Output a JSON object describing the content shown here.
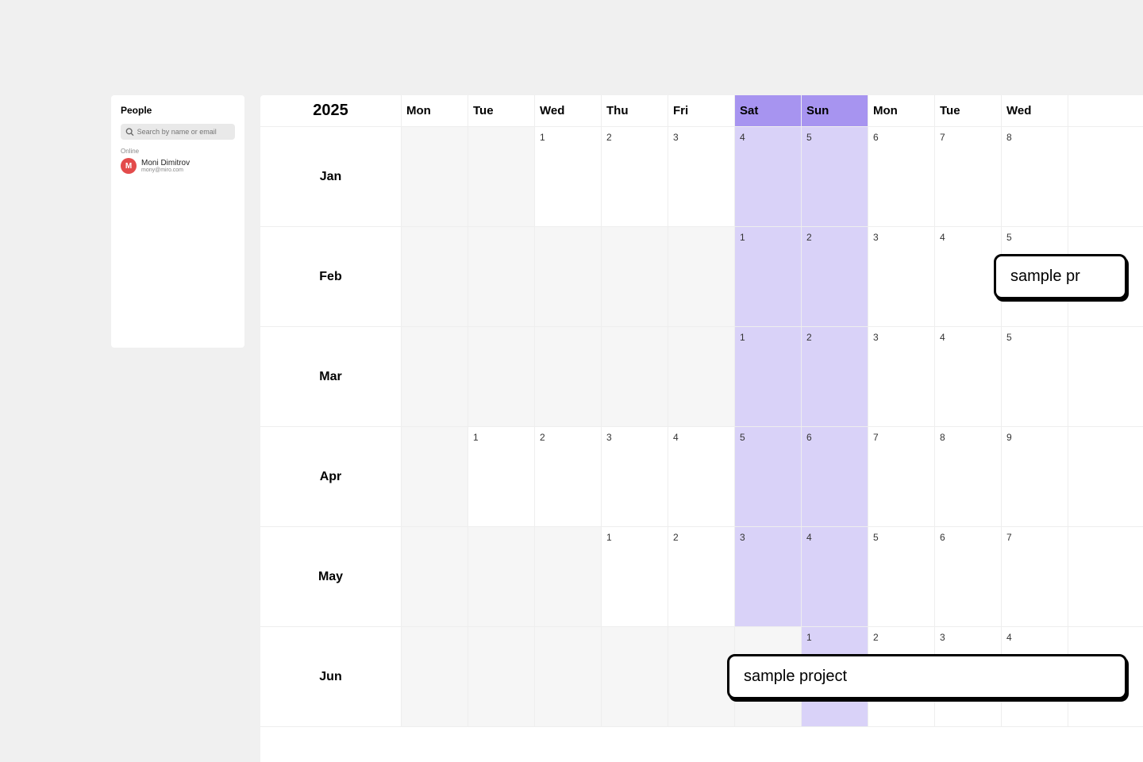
{
  "people": {
    "title": "People",
    "search_placeholder": "Search by name or email",
    "online_label": "Online",
    "user": {
      "initial": "M",
      "name": "Moni Dimitrov",
      "email": "mony@miro.com"
    }
  },
  "calendar": {
    "year": "2025",
    "day_headers": [
      {
        "label": "Mon",
        "weekend": false
      },
      {
        "label": "Tue",
        "weekend": false
      },
      {
        "label": "Wed",
        "weekend": false
      },
      {
        "label": "Thu",
        "weekend": false
      },
      {
        "label": "Fri",
        "weekend": false
      },
      {
        "label": "Sat",
        "weekend": true
      },
      {
        "label": "Sun",
        "weekend": true
      },
      {
        "label": "Mon",
        "weekend": false
      },
      {
        "label": "Tue",
        "weekend": false
      },
      {
        "label": "Wed",
        "weekend": false
      }
    ],
    "months": [
      {
        "label": "Jan",
        "cells": [
          {
            "n": "",
            "empty": true
          },
          {
            "n": "",
            "empty": true
          },
          {
            "n": "1"
          },
          {
            "n": "2"
          },
          {
            "n": "3"
          },
          {
            "n": "4",
            "weekend": true
          },
          {
            "n": "5",
            "weekend": true
          },
          {
            "n": "6"
          },
          {
            "n": "7"
          },
          {
            "n": "8"
          }
        ]
      },
      {
        "label": "Feb",
        "cells": [
          {
            "n": "",
            "empty": true
          },
          {
            "n": "",
            "empty": true
          },
          {
            "n": "",
            "empty": true
          },
          {
            "n": "",
            "empty": true
          },
          {
            "n": "",
            "empty": true
          },
          {
            "n": "1",
            "weekend": true
          },
          {
            "n": "2",
            "weekend": true
          },
          {
            "n": "3"
          },
          {
            "n": "4"
          },
          {
            "n": "5"
          }
        ]
      },
      {
        "label": "Mar",
        "cells": [
          {
            "n": "",
            "empty": true
          },
          {
            "n": "",
            "empty": true
          },
          {
            "n": "",
            "empty": true
          },
          {
            "n": "",
            "empty": true
          },
          {
            "n": "",
            "empty": true
          },
          {
            "n": "1",
            "weekend": true
          },
          {
            "n": "2",
            "weekend": true
          },
          {
            "n": "3"
          },
          {
            "n": "4"
          },
          {
            "n": "5"
          }
        ]
      },
      {
        "label": "Apr",
        "cells": [
          {
            "n": "",
            "empty": true
          },
          {
            "n": "1"
          },
          {
            "n": "2"
          },
          {
            "n": "3"
          },
          {
            "n": "4"
          },
          {
            "n": "5",
            "weekend": true
          },
          {
            "n": "6",
            "weekend": true
          },
          {
            "n": "7"
          },
          {
            "n": "8"
          },
          {
            "n": "9"
          }
        ]
      },
      {
        "label": "May",
        "cells": [
          {
            "n": "",
            "empty": true
          },
          {
            "n": "",
            "empty": true
          },
          {
            "n": "",
            "empty": true
          },
          {
            "n": "1"
          },
          {
            "n": "2"
          },
          {
            "n": "3",
            "weekend": true
          },
          {
            "n": "4",
            "weekend": true
          },
          {
            "n": "5"
          },
          {
            "n": "6"
          },
          {
            "n": "7"
          }
        ]
      },
      {
        "label": "Jun",
        "cells": [
          {
            "n": "",
            "empty": true
          },
          {
            "n": "",
            "empty": true
          },
          {
            "n": "",
            "empty": true
          },
          {
            "n": "",
            "empty": true
          },
          {
            "n": "",
            "empty": true
          },
          {
            "n": "",
            "empty": true
          },
          {
            "n": "1",
            "weekend": true
          },
          {
            "n": "2"
          },
          {
            "n": "3"
          },
          {
            "n": "4"
          }
        ]
      }
    ],
    "events": [
      {
        "title": "sample pr",
        "month_index": 1,
        "col_start": 9,
        "width_cols": 2
      },
      {
        "title": "sample project",
        "month_index": 5,
        "col_start": 5,
        "width_cols": 6
      }
    ]
  }
}
